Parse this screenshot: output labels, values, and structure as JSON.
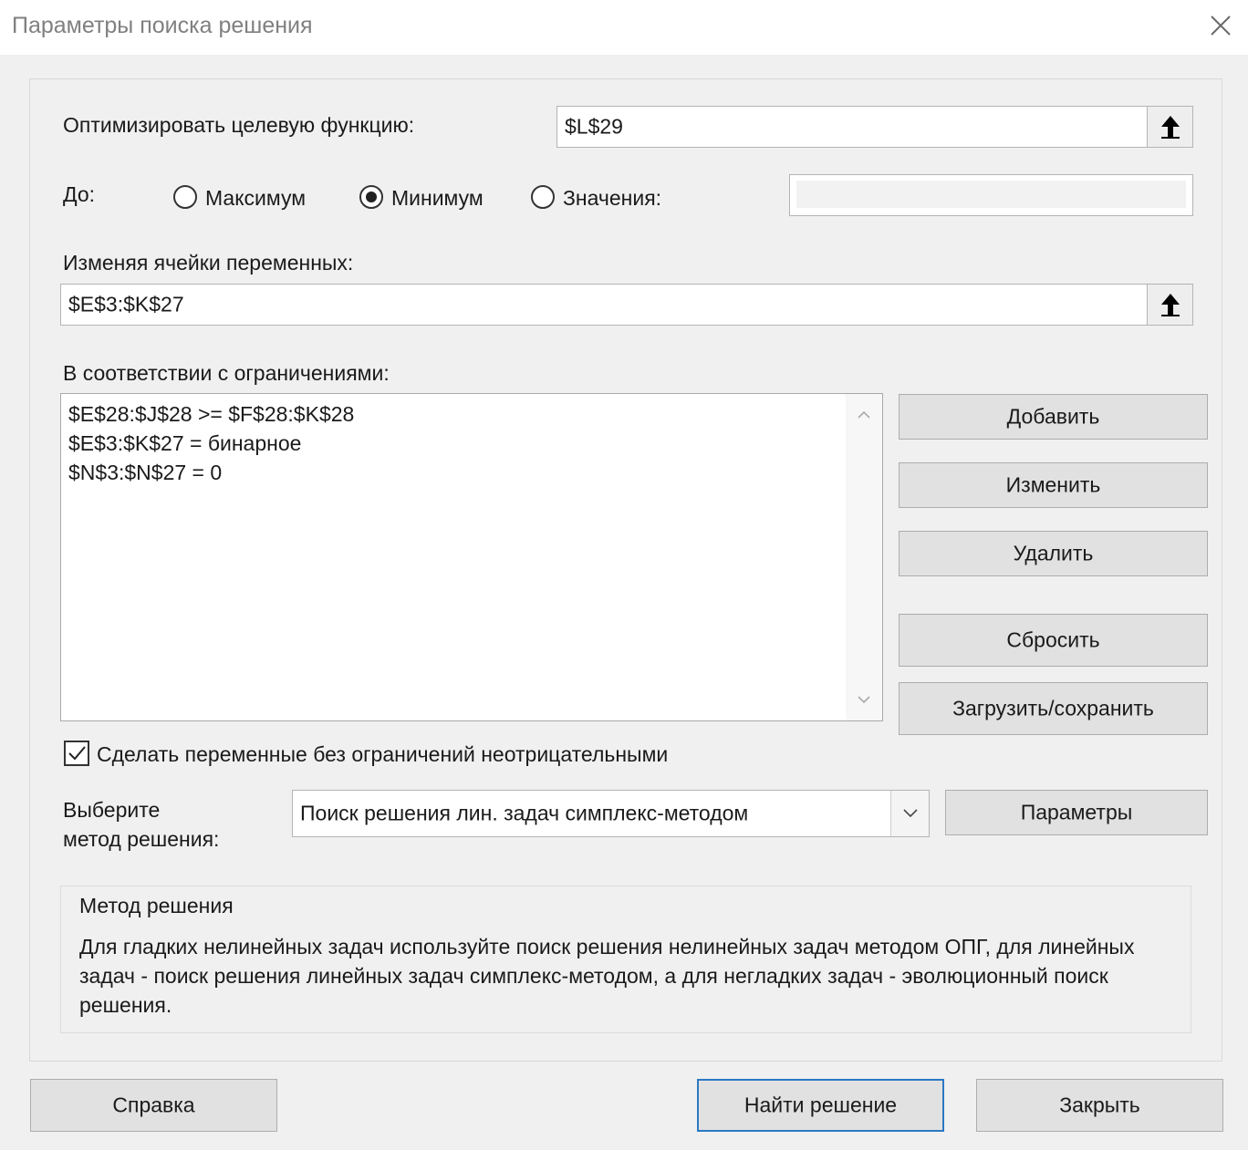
{
  "window": {
    "title": "Параметры поиска решения"
  },
  "objective": {
    "label": "Оптимизировать целевую функцию:",
    "value": "$L$29"
  },
  "to": {
    "label": "До:",
    "options": [
      {
        "label": "Максимум",
        "selected": false
      },
      {
        "label": "Минимум",
        "selected": true
      },
      {
        "label": "Значения:",
        "selected": false
      }
    ],
    "value_field": ""
  },
  "variables": {
    "label": "Изменяя ячейки переменных:",
    "value": "$E$3:$K$27"
  },
  "constraints": {
    "label": "В соответствии с ограничениями:",
    "items": [
      "$E$28:$J$28 >= $F$28:$K$28",
      "$E$3:$K$27 = бинарное",
      "$N$3:$N$27 = 0"
    ]
  },
  "side_buttons": {
    "add": "Добавить",
    "change": "Изменить",
    "delete": "Удалить",
    "reset": "Сбросить",
    "load_save": "Загрузить/сохранить"
  },
  "nonnegative": {
    "label": "Сделать переменные без ограничений неотрицательными",
    "checked": true
  },
  "method": {
    "label_line1": "Выберите",
    "label_line2": "метод решения:",
    "selected": "Поиск решения лин. задач симплекс-методом",
    "options_button": "Параметры"
  },
  "method_description": {
    "title": "Метод решения",
    "text": "Для гладких нелинейных задач используйте поиск решения нелинейных задач методом ОПГ, для линейных задач - поиск решения линейных задач симплекс-методом, а для негладких задач - эволюционный поиск решения."
  },
  "footer": {
    "help": "Справка",
    "solve": "Найти решение",
    "close": "Закрыть"
  },
  "colors": {
    "primary_border": "#2b78c5",
    "button_bg": "#e1e1e1",
    "dialog_bg": "#f0f0f0"
  },
  "icons": {
    "close": "close-icon",
    "ref": "arrow-up-icon",
    "dropdown": "chevron-down-icon",
    "check": "checkmark-icon"
  }
}
